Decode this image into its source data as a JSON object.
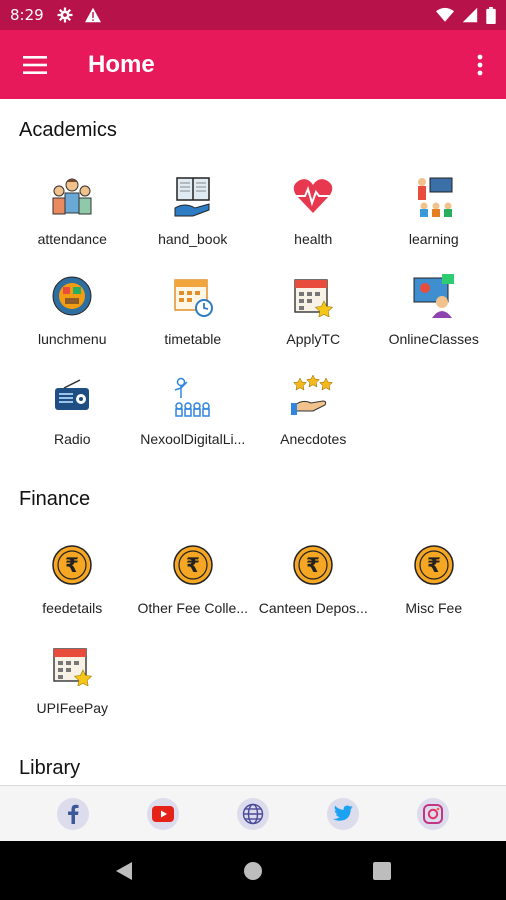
{
  "status_bar": {
    "time": "8:29"
  },
  "app_bar": {
    "title": "Home"
  },
  "sections": [
    {
      "title": "Academics",
      "items": [
        {
          "label": "attendance",
          "icon": "people-icon"
        },
        {
          "label": "hand_book",
          "icon": "book-icon"
        },
        {
          "label": "health",
          "icon": "heart-icon"
        },
        {
          "label": "learning",
          "icon": "classroom-icon"
        },
        {
          "label": "lunchmenu",
          "icon": "plate-icon"
        },
        {
          "label": "timetable",
          "icon": "calendar-clock-icon"
        },
        {
          "label": "ApplyTC",
          "icon": "calendar-star-icon"
        },
        {
          "label": "OnlineClasses",
          "icon": "monitor-person-icon"
        },
        {
          "label": "Radio",
          "icon": "radio-icon"
        },
        {
          "label": "NexoolDigitalLi...",
          "icon": "library-people-icon"
        },
        {
          "label": "Anecdotes",
          "icon": "stars-hand-icon"
        }
      ]
    },
    {
      "title": "Finance",
      "items": [
        {
          "label": "feedetails",
          "icon": "rupee-coin-icon"
        },
        {
          "label": "Other Fee Colle...",
          "icon": "rupee-coin-icon"
        },
        {
          "label": "Canteen Depos...",
          "icon": "rupee-coin-icon"
        },
        {
          "label": "Misc Fee",
          "icon": "rupee-coin-icon"
        },
        {
          "label": "UPIFeePay",
          "icon": "calendar-star-icon"
        }
      ]
    },
    {
      "title": "Library",
      "items": []
    }
  ],
  "social": [
    {
      "icon": "facebook-icon"
    },
    {
      "icon": "youtube-icon"
    },
    {
      "icon": "globe-icon"
    },
    {
      "icon": "twitter-icon"
    },
    {
      "icon": "instagram-icon"
    }
  ],
  "colors": {
    "status_bar": "#b8124a",
    "app_bar": "#e8195b",
    "coin": "#f5a623"
  }
}
